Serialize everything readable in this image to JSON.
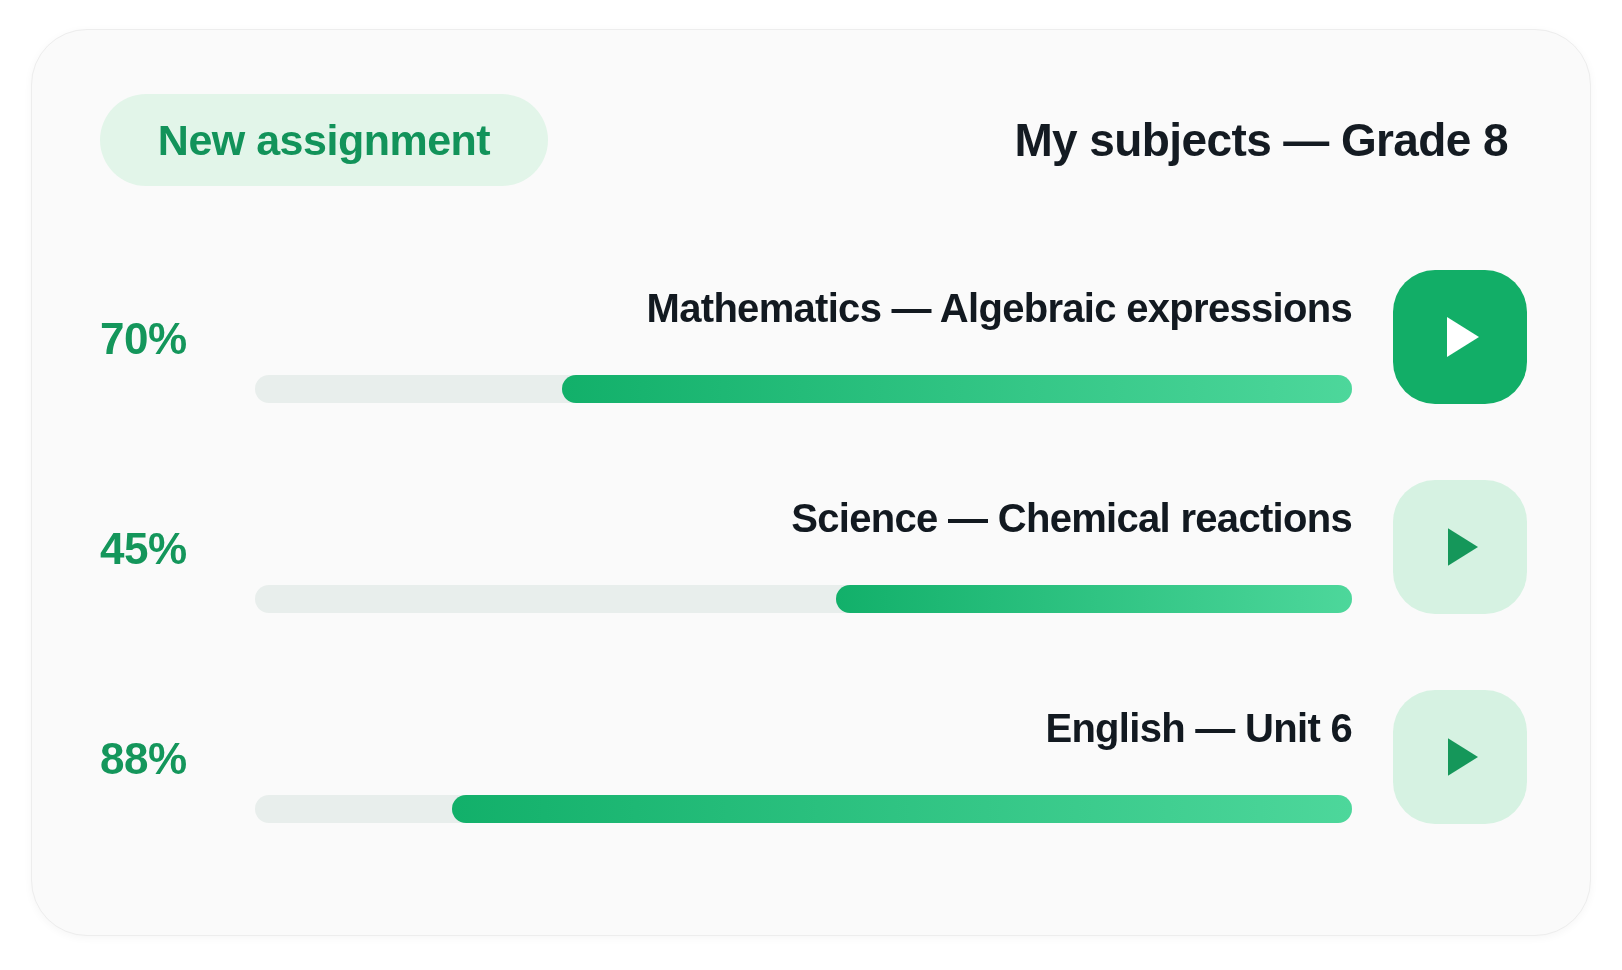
{
  "new_assignment_button": {
    "label": "New assignment"
  },
  "title": "My subjects — Grade 8",
  "subjects": [
    {
      "percent": "70%",
      "title": "Mathematics — Algebraic expressions",
      "level": 0.72,
      "selected": true
    },
    {
      "percent": "45%",
      "title": "Science — Chemical reactions",
      "level": 0.47,
      "selected": false
    },
    {
      "percent": "88%",
      "title": "English — Unit 6",
      "level": 0.82,
      "selected": false
    }
  ]
}
